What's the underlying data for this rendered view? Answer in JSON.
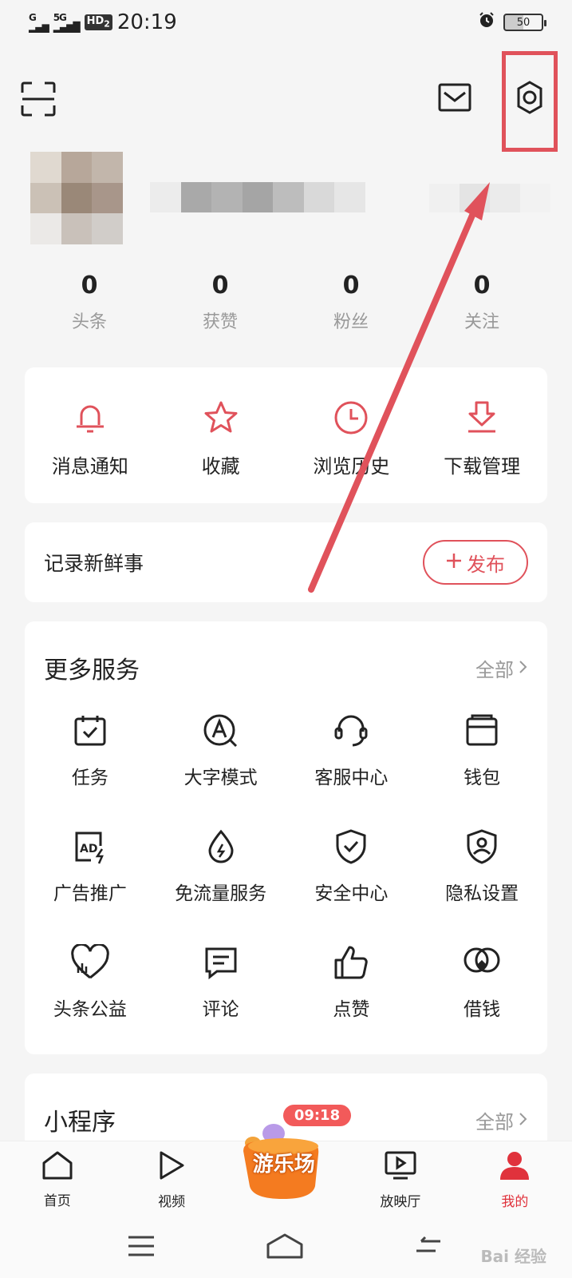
{
  "status_bar": {
    "network": "G",
    "network_5g": "5G",
    "hd": "HD",
    "hd_sub": "2",
    "time": "20:19",
    "battery": "50"
  },
  "stats": [
    {
      "value": "0",
      "label": "头条"
    },
    {
      "value": "0",
      "label": "获赞"
    },
    {
      "value": "0",
      "label": "粉丝"
    },
    {
      "value": "0",
      "label": "关注"
    }
  ],
  "quick_actions": [
    {
      "label": "消息通知",
      "icon": "bell-icon"
    },
    {
      "label": "收藏",
      "icon": "star-icon"
    },
    {
      "label": "浏览历史",
      "icon": "clock-icon"
    },
    {
      "label": "下载管理",
      "icon": "download-icon"
    }
  ],
  "post": {
    "title": "记录新鲜事",
    "button_label": "发布"
  },
  "services": {
    "title": "更多服务",
    "more": "全部",
    "items": [
      {
        "label": "任务",
        "icon": "task-calendar-icon"
      },
      {
        "label": "大字模式",
        "icon": "large-font-icon"
      },
      {
        "label": "客服中心",
        "icon": "headset-icon"
      },
      {
        "label": "钱包",
        "icon": "wallet-icon"
      },
      {
        "label": "广告推广",
        "icon": "ad-icon"
      },
      {
        "label": "免流量服务",
        "icon": "water-drop-icon"
      },
      {
        "label": "安全中心",
        "icon": "shield-check-icon"
      },
      {
        "label": "隐私设置",
        "icon": "privacy-user-icon"
      },
      {
        "label": "头条公益",
        "icon": "charity-heart-icon"
      },
      {
        "label": "评论",
        "icon": "comment-icon"
      },
      {
        "label": "点赞",
        "icon": "thumbs-up-icon"
      },
      {
        "label": "借钱",
        "icon": "loan-icon"
      }
    ]
  },
  "mini_programs": {
    "title": "小程序",
    "more": "全部"
  },
  "tabs": [
    {
      "label": "首页",
      "icon": "home-icon"
    },
    {
      "label": "视频",
      "icon": "play-icon"
    },
    {
      "label": "游乐场",
      "icon": "playground-badge",
      "timer": "09:18"
    },
    {
      "label": "放映厅",
      "icon": "screen-icon"
    },
    {
      "label": "我的",
      "icon": "user-icon"
    }
  ],
  "watermark": "Bai 经验",
  "colors": {
    "accent": "#e0525b",
    "active_tab": "#e0323c",
    "annotation": "#e0525b"
  }
}
